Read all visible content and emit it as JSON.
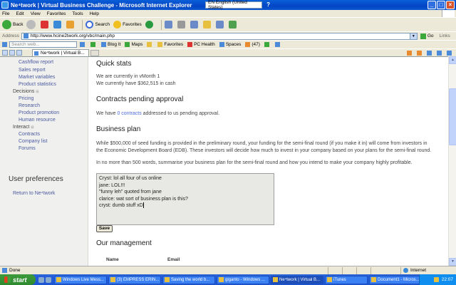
{
  "window": {
    "title": "Ne⁴twork | Virtual Business Challenge - Microsoft Internet Explorer",
    "language": "EN English (United States)",
    "help_mark": "?"
  },
  "menu": [
    "File",
    "Edit",
    "View",
    "Favorites",
    "Tools",
    "Help"
  ],
  "toolbar": {
    "back_label": "Back",
    "search_label": "Search",
    "favorites_label": "Favorites"
  },
  "address": {
    "label": "Address",
    "url": "http://www.hcine2twork.org/vbc/main.php",
    "go_label": "Go",
    "links_label": "Links"
  },
  "links_bar": {
    "search_placeholder": "Search web...",
    "items": [
      "Blog It",
      "Maps",
      "Favorites",
      "PC Health",
      "Spaces",
      "(47)"
    ]
  },
  "tab": {
    "title": "Ne⁴twork | Virtual B..."
  },
  "sidebar": {
    "items": [
      {
        "label": "Cashflow report",
        "type": "link"
      },
      {
        "label": "Sales report",
        "type": "link"
      },
      {
        "label": "Market variables",
        "type": "link"
      },
      {
        "label": "Product statistics",
        "type": "link"
      },
      {
        "label": "Decisions",
        "type": "head"
      },
      {
        "label": "Pricing",
        "type": "link"
      },
      {
        "label": "Research",
        "type": "link"
      },
      {
        "label": "Product promotion",
        "type": "link"
      },
      {
        "label": "Human resource",
        "type": "link"
      },
      {
        "label": "Interact",
        "type": "head"
      },
      {
        "label": "Contracts",
        "type": "link"
      },
      {
        "label": "Company list",
        "type": "link"
      },
      {
        "label": "Forums",
        "type": "link"
      }
    ],
    "prefs_title": "User preferences",
    "return_link": "Return to Ne⁴twork"
  },
  "main": {
    "quick_stats_heading": "Quick stats",
    "stats_line1": "We are currently in vMonth 1",
    "stats_line2": "We currently have $362,515 in cash",
    "contracts_heading": "Contracts pending approval",
    "contracts_prefix": "We have ",
    "contracts_link": "0 contracts",
    "contracts_suffix": " addressed to us pending approval.",
    "plan_heading": "Business plan",
    "plan_para1_line1": "While $500,000 of seed funding is provided in the preliminary round, your funding for the semi-final round (if you make it in) will come from investors in",
    "plan_para1_line2": "the Economic Development Board (EDB). These investors will decide how much to invest in your company based on your plans for the semi-final round.",
    "plan_para2": "In no more than 500 words, summarise your business plan for the semi-final round and how you intend to make your company highly profitable.",
    "plan_text": [
      "Cryst: lol all four of us online",
      "jane: LOL!!!",
      "\"funny leh\" quoted from jane",
      "clarice: wat sort of business plan is this?",
      "cryst: dumb stuff xD"
    ],
    "save_label": "Save",
    "management_heading": "Our management",
    "col_name": "Name",
    "col_email": "Email"
  },
  "status": {
    "text": "Done",
    "zone": "Internet"
  },
  "taskbar": {
    "start": "start",
    "tasks": [
      {
        "label": "Windows Live Mess...",
        "active": false
      },
      {
        "label": "(3) EMPRESS ERIN...",
        "active": false
      },
      {
        "label": "Saving the world b...",
        "active": false
      },
      {
        "label": "giganto - Windows ...",
        "active": false
      },
      {
        "label": "Ne⁴twork | Virtual B...",
        "active": true
      },
      {
        "label": "iTunes",
        "active": false
      },
      {
        "label": "Document1 - Micros...",
        "active": false
      }
    ],
    "clock": "22:07"
  },
  "colors": {
    "link": "#4a6ad8",
    "titlebar": "#0a5fd8",
    "taskbar": "#245edc",
    "start": "#3c9a3c"
  }
}
